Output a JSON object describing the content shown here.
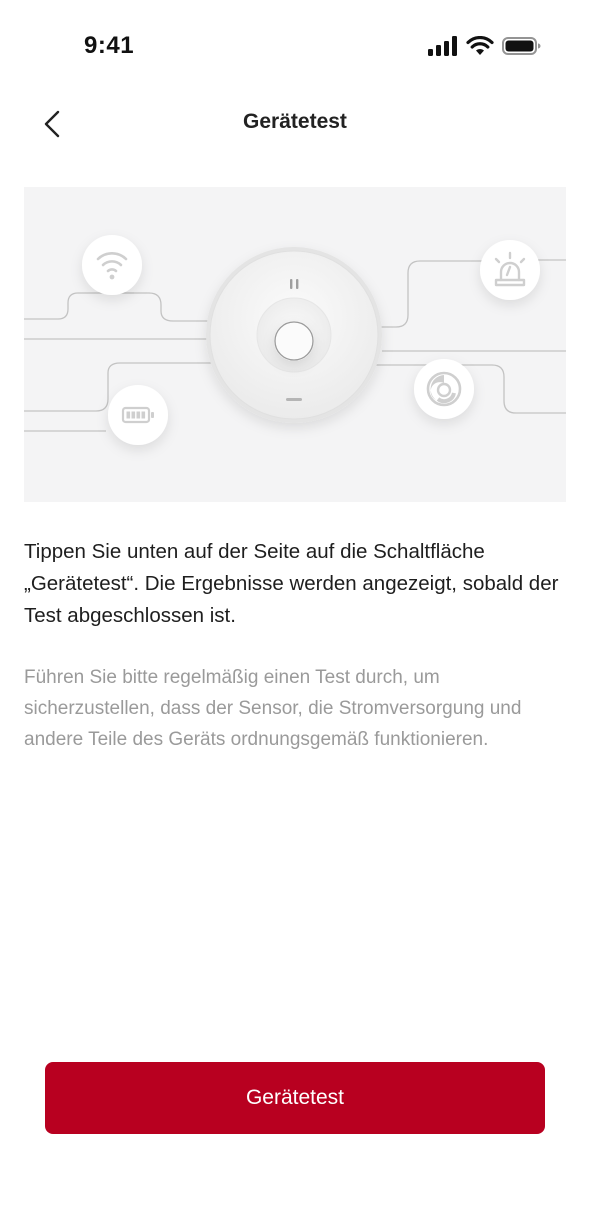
{
  "status_bar": {
    "time": "9:41",
    "icons": [
      "cellular-signal-icon",
      "wifi-icon",
      "battery-icon"
    ]
  },
  "nav": {
    "title": "Gerätetest",
    "back_icon": "chevron-left-icon"
  },
  "illustration": {
    "icons": [
      "wifi-icon",
      "siren-icon",
      "battery-icon",
      "smoke-sensor-icon",
      "smoke-detector-device"
    ]
  },
  "content": {
    "primary": "Tippen Sie unten auf der Seite auf die Schaltfläche „Gerätetest“. Die Ergebnisse werden angezeigt, sobald der Test abgeschlossen ist.",
    "secondary": "Führen Sie bitte regelmäßig einen Test durch, um sicherzustellen, dass der Sensor, die Stromversorgung und andere Teile des Geräts ordnungsgemäß funktionieren."
  },
  "actions": {
    "test_button_label": "Gerätetest"
  },
  "colors": {
    "accent": "#b80020",
    "illustration_bg": "#f4f4f5",
    "secondary_text": "#9a9a9a"
  }
}
